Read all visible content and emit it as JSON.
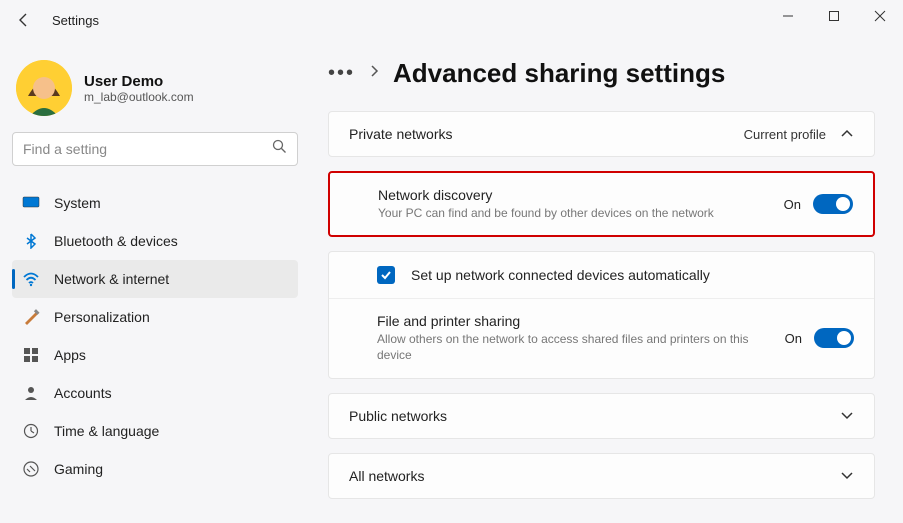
{
  "window": {
    "title": "Settings"
  },
  "user": {
    "name": "User Demo",
    "email": "m_lab@outlook.com"
  },
  "search": {
    "placeholder": "Find a setting"
  },
  "nav": [
    {
      "key": "system",
      "label": "System"
    },
    {
      "key": "bluetooth",
      "label": "Bluetooth & devices"
    },
    {
      "key": "network",
      "label": "Network & internet",
      "active": true
    },
    {
      "key": "personalization",
      "label": "Personalization"
    },
    {
      "key": "apps",
      "label": "Apps"
    },
    {
      "key": "accounts",
      "label": "Accounts"
    },
    {
      "key": "time",
      "label": "Time & language"
    },
    {
      "key": "gaming",
      "label": "Gaming"
    }
  ],
  "breadcrumb": {
    "page_title": "Advanced sharing settings"
  },
  "sections": {
    "private": {
      "title": "Private networks",
      "badge": "Current profile",
      "network_discovery": {
        "title": "Network discovery",
        "desc": "Your PC can find and be found by other devices on the network",
        "state": "On"
      },
      "auto_setup": {
        "label": "Set up network connected devices automatically"
      },
      "file_printer": {
        "title": "File and printer sharing",
        "desc": "Allow others on the network to access shared files and printers on this device",
        "state": "On"
      }
    },
    "public": {
      "title": "Public networks"
    },
    "all": {
      "title": "All networks"
    }
  }
}
